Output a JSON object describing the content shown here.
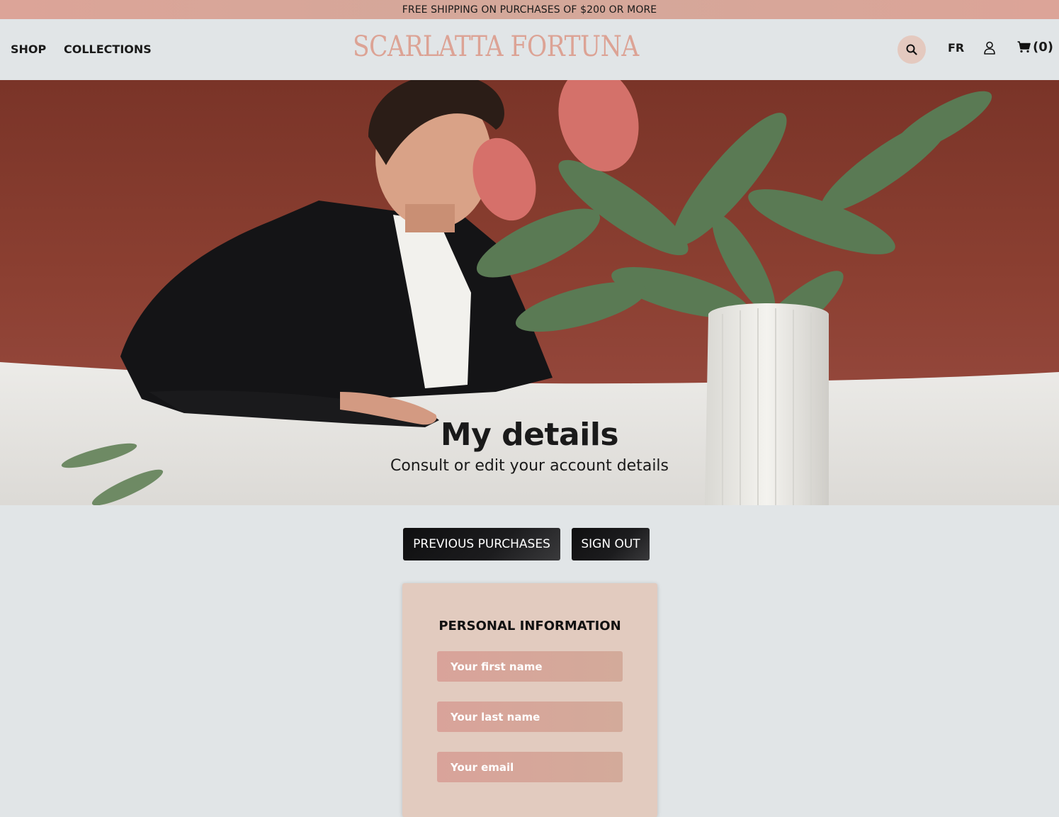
{
  "announcement": "FREE SHIPPING ON PURCHASES OF $200 OR MORE",
  "nav": {
    "shop": "SHOP",
    "collections": "COLLECTIONS"
  },
  "brand": {
    "name": "SCARLATTA FORTUNA",
    "color": "#dca395"
  },
  "header_actions": {
    "search_icon": "search-icon",
    "language": "FR",
    "account_icon": "user-icon",
    "cart_icon": "cart-icon",
    "cart_count": "(0)"
  },
  "hero": {
    "title": "My details",
    "subtitle": "Consult or edit your account details"
  },
  "account_actions": {
    "previous_purchases": "PREVIOUS PURCHASES",
    "sign_out": "SIGN OUT"
  },
  "personal_info": {
    "title": "PERSONAL INFORMATION",
    "first_name_placeholder": "Your first name",
    "last_name_placeholder": "Your last name",
    "email_placeholder": "Your email"
  },
  "colors": {
    "background": "#e1e5e7",
    "accent": "#dca395",
    "card": "#e2cbbf",
    "button": "#1a1a1a"
  }
}
